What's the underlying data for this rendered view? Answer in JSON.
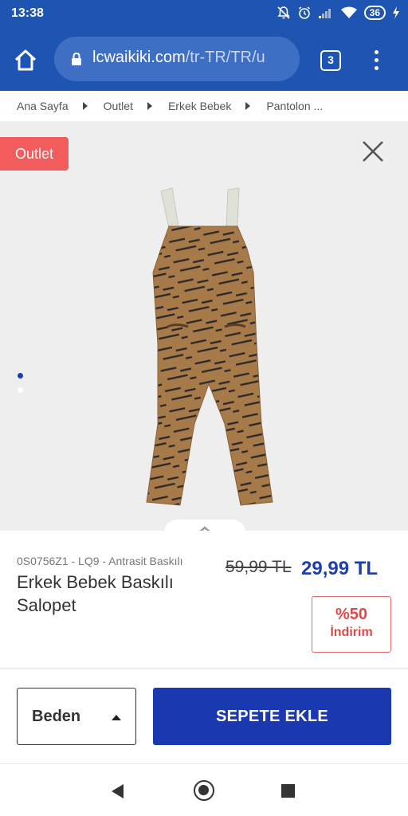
{
  "status_bar": {
    "time": "13:38",
    "battery": "36",
    "icons": [
      "mute-icon",
      "alarm-icon",
      "signal-icon",
      "wifi-icon",
      "battery-icon",
      "charging-icon"
    ]
  },
  "browser": {
    "url_domain": "lcwaikiki.com",
    "url_path": "/tr-TR/TR/u",
    "tab_count": "3"
  },
  "breadcrumb": {
    "items": [
      "Ana Sayfa",
      "Outlet",
      "Erkek Bebek",
      "Pantolon ..."
    ]
  },
  "gallery": {
    "badge": "Outlet",
    "image_count": 2,
    "active_image": 1
  },
  "product": {
    "sku": "0S0756Z1 - LQ9 - Antrasit Baskılı",
    "title": "Erkek Bebek Baskılı Salopet",
    "old_price": "59,99 TL",
    "new_price": "29,99 TL",
    "discount_pct": "%50",
    "discount_label": "İndirim"
  },
  "actions": {
    "size_label": "Beden",
    "add_to_cart": "SEPETE EKLE"
  },
  "colors": {
    "brand_blue": "#1f55b2",
    "button_blue": "#1a39b0",
    "outlet_red": "#f25c5c",
    "discount_red": "#e04848"
  }
}
